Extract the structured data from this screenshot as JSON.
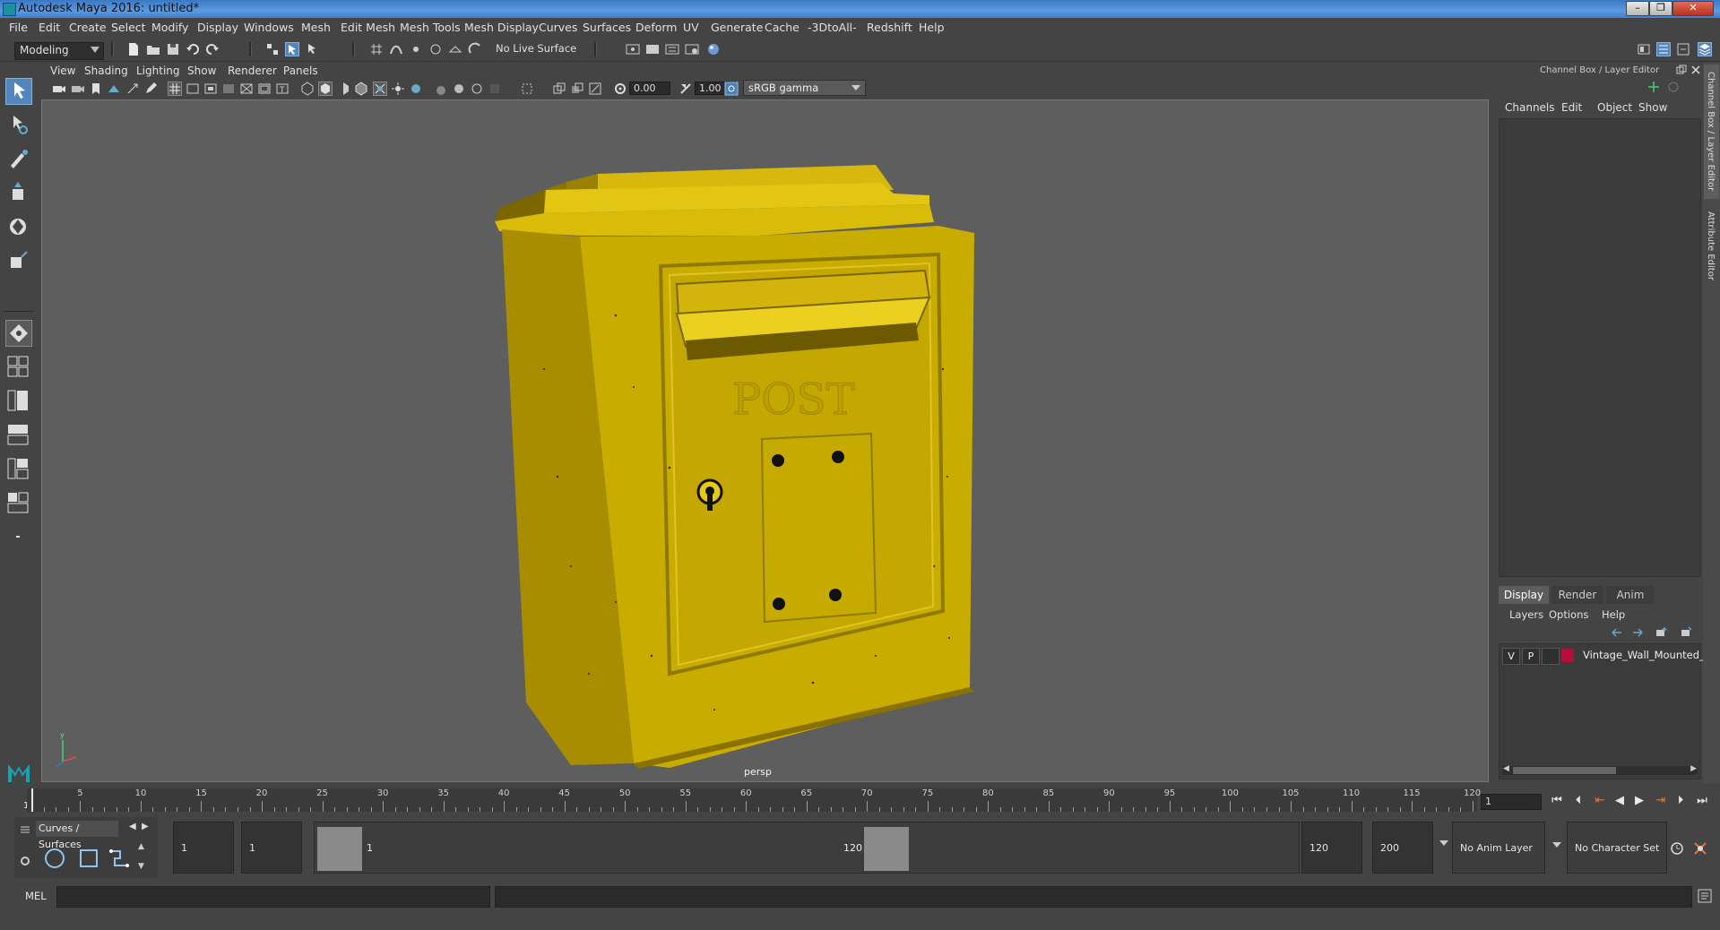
{
  "window": {
    "title": "Autodesk Maya 2016: untitled*"
  },
  "menu": [
    "File",
    "Edit",
    "Create",
    "Select",
    "Modify",
    "Display",
    "Windows",
    "Mesh",
    "Edit Mesh",
    "Mesh Tools",
    "Mesh Display",
    "Curves",
    "Surfaces",
    "Deform",
    "UV",
    "Generate",
    "Cache",
    "-3DtoAll-",
    "Redshift",
    "Help"
  ],
  "status_line": {
    "mode": "Modeling",
    "live_surface": "No Live Surface"
  },
  "viewport": {
    "menu": [
      "View",
      "Shading",
      "Lighting",
      "Show",
      "Renderer",
      "Panels"
    ],
    "exposure": "0.00",
    "gamma": "1.00",
    "color_space": "sRGB gamma",
    "camera_label": "persp",
    "model_text": "POST",
    "model_color": "#c9a800"
  },
  "channel_box": {
    "title": "Channel Box / Layer Editor",
    "menu": [
      "Channels",
      "Edit",
      "Object",
      "Show"
    ],
    "tabs": [
      "Display",
      "Render",
      "Anim"
    ],
    "active_tab": "Display",
    "layer_menu": [
      "Layers",
      "Options",
      "Help"
    ],
    "layers": [
      {
        "v": "V",
        "p": "P",
        "color": "#b0103a",
        "name": "Vintage_Wall_Mounted_"
      }
    ],
    "side_tabs": [
      "Channel Box / Layer Editor",
      "Attribute Editor"
    ]
  },
  "time_slider": {
    "ticks": [
      5,
      10,
      15,
      20,
      25,
      30,
      35,
      40,
      45,
      50,
      55,
      60,
      65,
      70,
      75,
      80,
      85,
      90,
      95,
      100,
      105,
      110,
      115,
      120
    ],
    "start_label": "1",
    "current_frame": "1"
  },
  "range_slider": {
    "shelf_tab": "Curves / Surfaces",
    "start_time": "1",
    "playback_start": "1",
    "range_start_label": "1",
    "range_end_label": "120",
    "playback_end": "120",
    "end_time": "200",
    "anim_layer": "No Anim Layer",
    "character_set": "No Character Set"
  },
  "command_line": {
    "label": "MEL"
  }
}
